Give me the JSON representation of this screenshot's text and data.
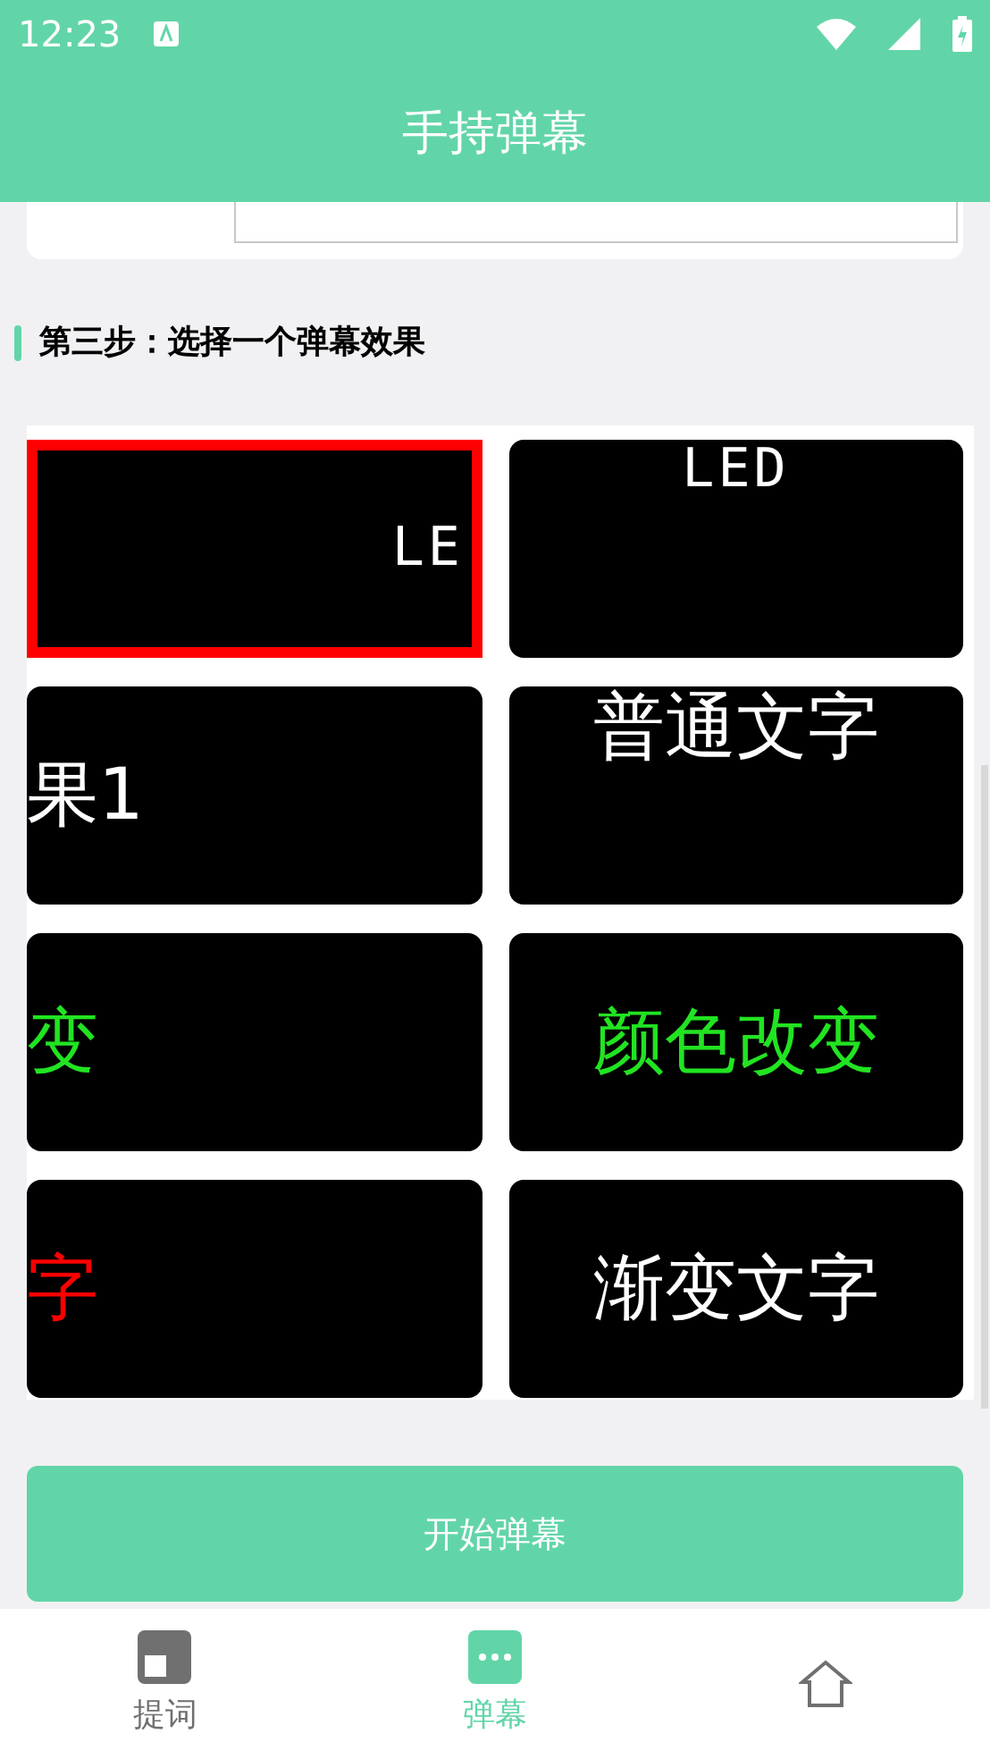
{
  "status_bar": {
    "time": "12:23"
  },
  "header": {
    "title": "手持弹幕"
  },
  "step": {
    "label": "第三步：选择一个弹幕效果"
  },
  "effects": [
    {
      "kind": "led",
      "text": "LE",
      "color": "#ffffff",
      "selected": true
    },
    {
      "kind": "led",
      "text": "LED",
      "color": "#ffffff",
      "selected": false
    },
    {
      "kind": "plain",
      "text": "果1",
      "color": "#ffffff",
      "selected": false
    },
    {
      "kind": "plain",
      "text": "普通文字",
      "color": "#ffffff",
      "selected": false
    },
    {
      "kind": "plain",
      "text": "变",
      "color": "#22e322",
      "selected": false
    },
    {
      "kind": "plain",
      "text": "颜色改变",
      "color": "#22e322",
      "selected": false
    },
    {
      "kind": "plain",
      "text": "字",
      "color": "#ff0000",
      "selected": false
    },
    {
      "kind": "plain",
      "text": "渐变文字",
      "color": "#ffffff",
      "selected": false
    }
  ],
  "start_button": {
    "label": "开始弹幕"
  },
  "nav": [
    {
      "kind": "text",
      "label": "提词",
      "selected": false
    },
    {
      "kind": "danmaku",
      "label": "弹幕",
      "selected": true
    },
    {
      "kind": "home",
      "selected": false
    }
  ]
}
